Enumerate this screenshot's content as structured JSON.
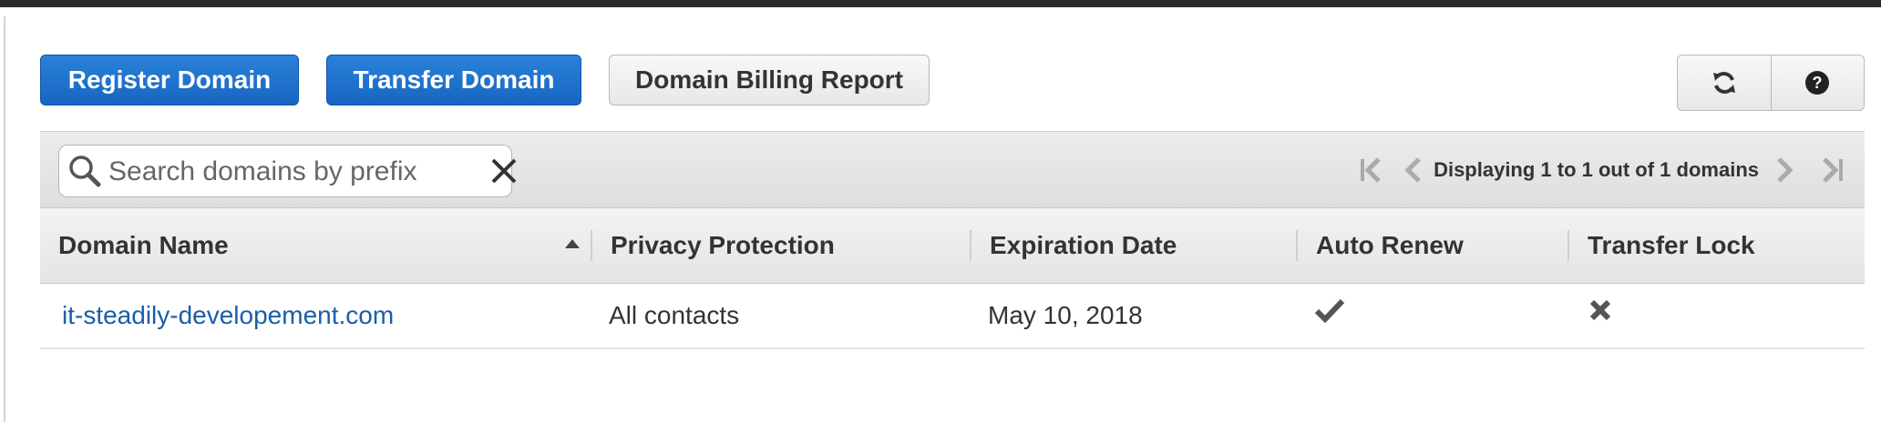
{
  "toolbar": {
    "register_label": "Register Domain",
    "transfer_label": "Transfer Domain",
    "billing_label": "Domain Billing Report",
    "refresh_icon": "refresh-icon",
    "help_icon": "help-icon"
  },
  "search": {
    "placeholder": "Search domains by prefix",
    "value": ""
  },
  "pagination": {
    "text": "Displaying 1 to 1 out of 1 domains"
  },
  "table": {
    "columns": [
      "Domain Name",
      "Privacy Protection",
      "Expiration Date",
      "Auto Renew",
      "Transfer Lock"
    ],
    "sorted_column": "Domain Name",
    "sort_direction": "ascending",
    "rows": [
      {
        "domain": "it-steadily-developement.com",
        "privacy": "All contacts",
        "expiration": "May 10, 2018",
        "auto_renew": true,
        "transfer_lock": false
      }
    ]
  },
  "colors": {
    "primary_button": "#1f73cf",
    "link": "#1a5ea8"
  }
}
